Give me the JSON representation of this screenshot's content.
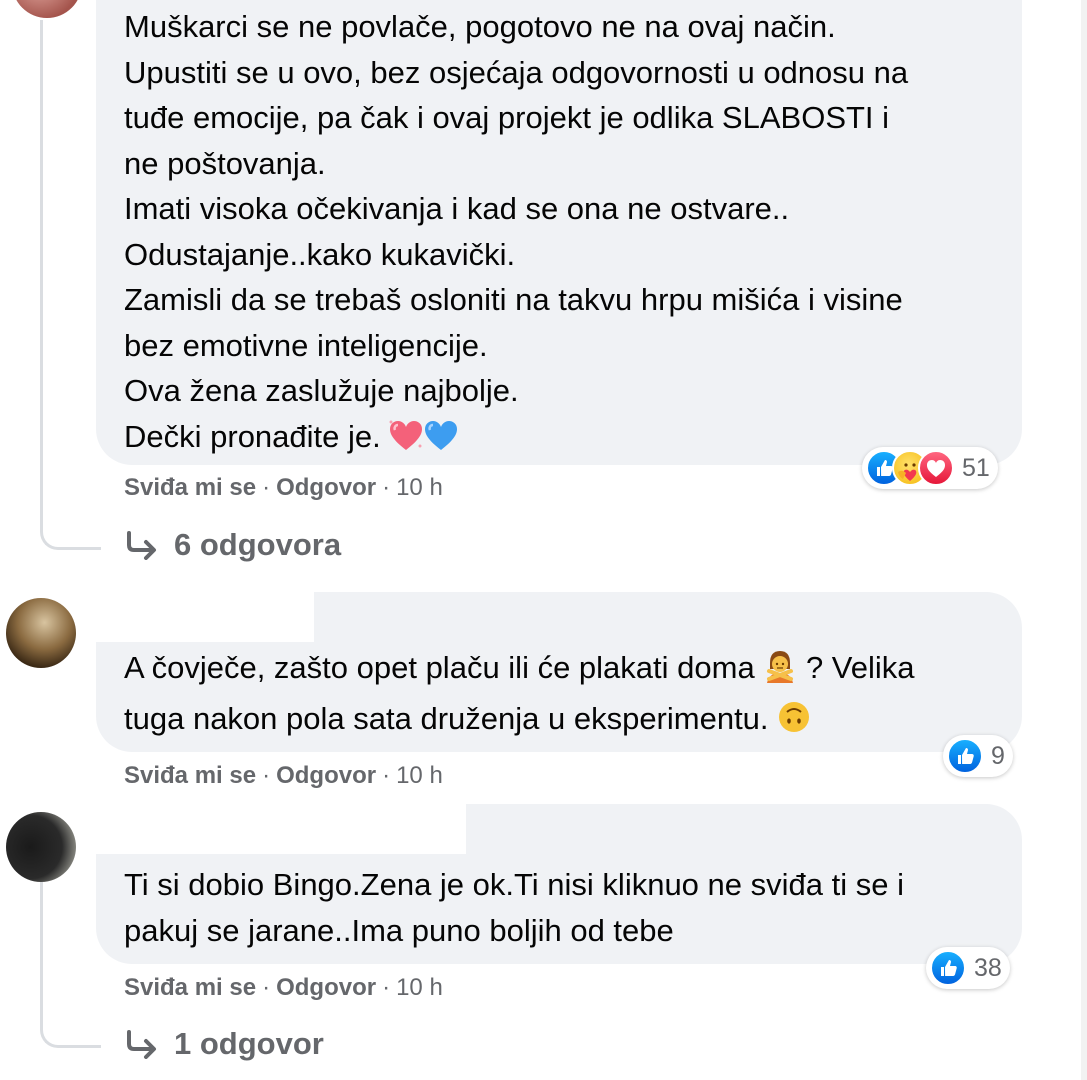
{
  "comments": [
    {
      "lines": [
        "Muškarci se ne povlače, pogotovo ne na ovaj način.",
        "Upustiti se u ovo, bez osjećaja odgovornosti u odnosu na",
        "tuđe emocije, pa čak i ovaj projekt je odlika SLABOSTI i",
        "ne poštovanja.",
        "Imati visoka očekivanja i kad se ona ne ostvare..",
        "Odustajanje..kako kukavički.",
        "Zamisli da se trebaš osloniti na takvu hrpu mišića i visine",
        "bez emotivne inteligencije.",
        "Ova žena zaslužuje najbolje.",
        "Dečki pronađite je."
      ],
      "reaction_icons": [
        "like-icon",
        "care-icon",
        "love-icon"
      ],
      "reaction_count": "51",
      "like_label": "Sviđa mi se",
      "reply_label": "Odgovor",
      "time": "10 h",
      "replies_label": "6 odgovora"
    },
    {
      "lines": [
        "A čovječe, zašto opet plaču ili će plakati doma",
        "? Velika",
        "tuga nakon pola sata druženja u eksperimentu."
      ],
      "reaction_icons": [
        "like-icon"
      ],
      "reaction_count": "9",
      "like_label": "Sviđa mi se",
      "reply_label": "Odgovor",
      "time": "10 h"
    },
    {
      "lines": [
        "Ti si dobio Bingo.Zena je ok.Ti nisi kliknuo ne sviđa ti se i",
        "pakuj se jarane..Ima puno boljih od tebe"
      ],
      "reaction_icons": [
        "like-icon"
      ],
      "reaction_count": "38",
      "like_label": "Sviđa mi se",
      "reply_label": "Odgovor",
      "time": "10 h",
      "replies_label": "1 odgovor"
    }
  ],
  "colors": {
    "bubble": "#f0f2f5",
    "meta": "#65676b",
    "like_blue": "#1877f2",
    "thread": "#dadde1"
  }
}
